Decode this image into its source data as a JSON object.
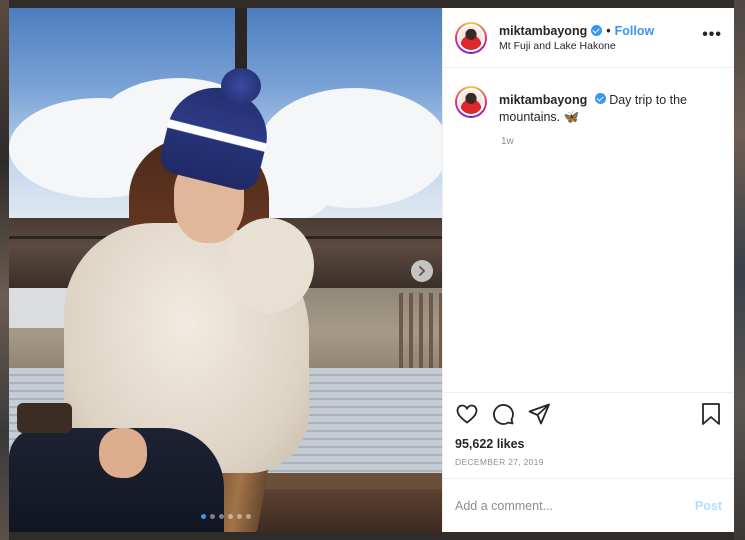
{
  "post": {
    "username": "miktambayong",
    "verified": true,
    "follow_label": "Follow",
    "bullet": "•",
    "location": "Mt Fuji and Lake Hakone",
    "more_label": "•••",
    "caption": {
      "username": "miktambayong",
      "text": "Day trip to the mountains.",
      "emoji": "🦋"
    },
    "time_ago": "1w",
    "likes": "95,622 likes",
    "date": "DECEMBER 27, 2019",
    "comment_placeholder": "Add a comment...",
    "post_label": "Post"
  },
  "carousel": {
    "slide_count": 6,
    "active_index": 0
  },
  "icons": {
    "like": "heart-icon",
    "comment": "comment-icon",
    "share": "share-icon",
    "save": "bookmark-icon",
    "next": "chevron-right-icon",
    "verified": "verified-badge-icon"
  },
  "colors": {
    "accent": "#3897f0",
    "post_disabled": "#b2dffc",
    "muted_text": "#8e8e8e",
    "text": "#262626"
  }
}
